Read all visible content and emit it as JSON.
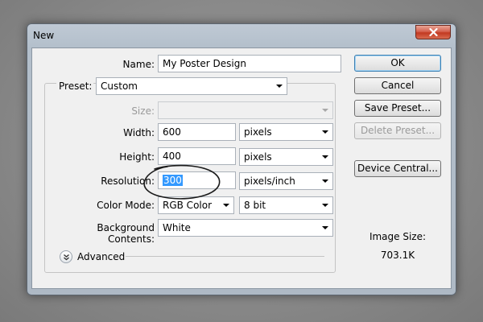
{
  "window": {
    "title": "New"
  },
  "form": {
    "name_label": "Name:",
    "name_value": "My Poster Design",
    "preset_label": "Preset:",
    "preset_value": "Custom",
    "size_label": "Size:",
    "size_value": "",
    "width_label": "Width:",
    "width_value": "600",
    "width_unit": "pixels",
    "height_label": "Height:",
    "height_value": "400",
    "height_unit": "pixels",
    "resolution_label": "Resolution:",
    "resolution_value": "300",
    "resolution_unit": "pixels/inch",
    "color_mode_label": "Color Mode:",
    "color_mode_value": "RGB Color",
    "bit_depth_value": "8 bit",
    "background_label": "Background Contents:",
    "background_value": "White",
    "advanced_label": "Advanced"
  },
  "buttons": {
    "ok": "OK",
    "cancel": "Cancel",
    "save_preset": "Save Preset...",
    "delete_preset": "Delete Preset...",
    "device_central": "Device Central..."
  },
  "image_size": {
    "label": "Image Size:",
    "value": "703.1K"
  },
  "colors": {
    "selection": "#3399ff",
    "annotation_circle": "#1a1a1a",
    "close_button": "#c23a22"
  },
  "icons": {
    "close": "close-icon",
    "dropdown": "chevron-down-icon",
    "advanced": "double-chevron-down-icon"
  }
}
